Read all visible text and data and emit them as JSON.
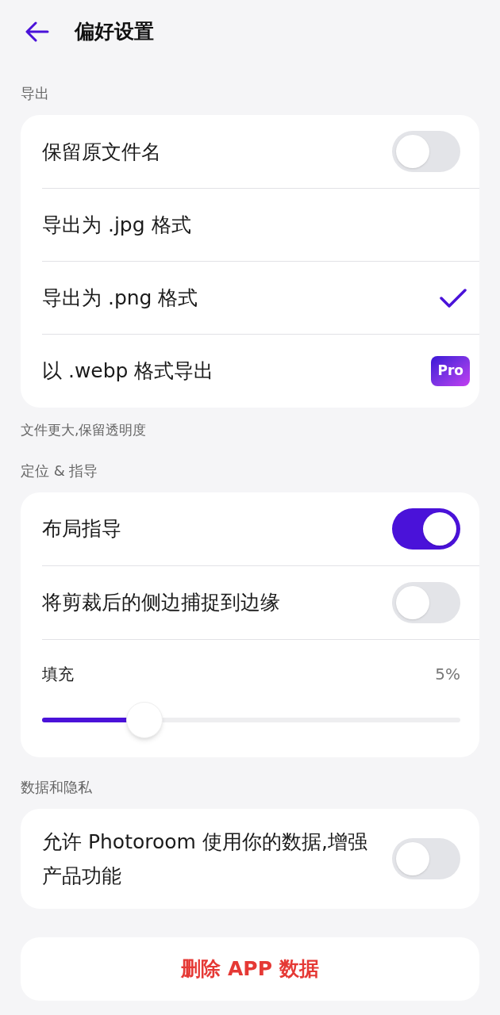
{
  "header": {
    "title": "偏好设置"
  },
  "sections": [
    {
      "title": "导出",
      "items": [
        {
          "kind": "toggle",
          "label": "保留原文件名",
          "on": false
        },
        {
          "kind": "option",
          "label": "导出为 .jpg 格式",
          "selected": false
        },
        {
          "kind": "option",
          "label": "导出为 .png 格式",
          "selected": true
        },
        {
          "kind": "pro",
          "label": "以 .webp 格式导出",
          "badge": "Pro"
        }
      ],
      "note": "文件更大,保留透明度"
    },
    {
      "title": "定位 & 指导",
      "items": [
        {
          "kind": "toggle",
          "label": "布局指导",
          "on": true
        },
        {
          "kind": "toggle",
          "label": "将剪裁后的侧边捕捉到边缘",
          "on": false
        },
        {
          "kind": "slider",
          "label": "填充",
          "reading": "5%",
          "level": 0.22
        }
      ]
    },
    {
      "title": "数据和隐私",
      "items": [
        {
          "kind": "toggle",
          "label": "允许 Photoroom 使用你的数据,增强产品功能",
          "on": false
        }
      ]
    }
  ],
  "danger_button": "删除 APP 数据"
}
